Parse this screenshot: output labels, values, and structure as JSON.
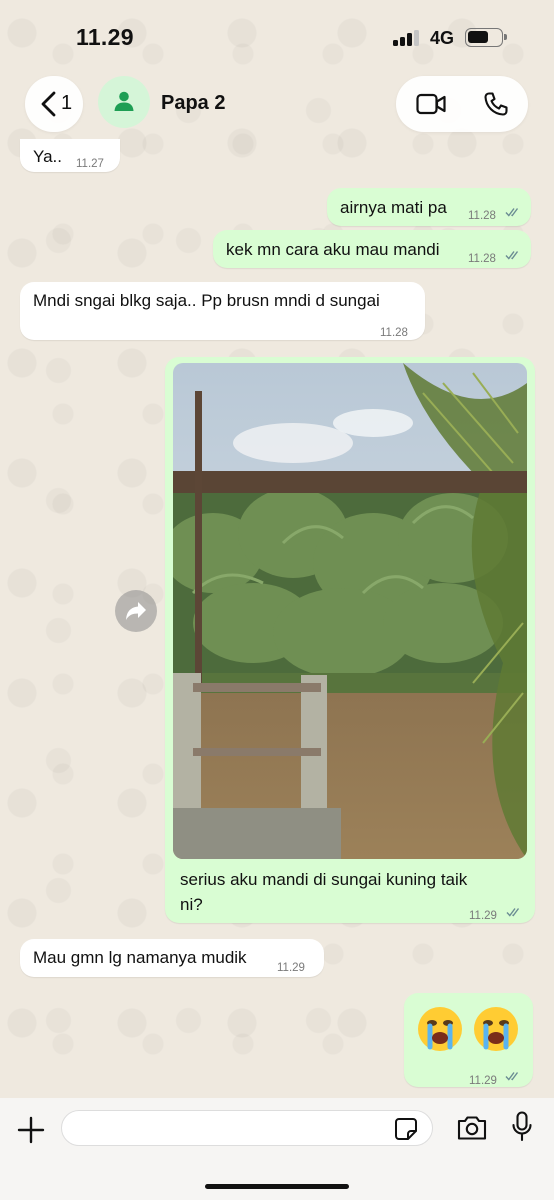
{
  "status_bar": {
    "time": "11.29",
    "network": "4G",
    "battery_level": 0.55
  },
  "header": {
    "back_count": "1",
    "contact_name": "Papa 2",
    "icons": [
      "back-chevron-icon",
      "person-icon",
      "video-call-icon",
      "phone-icon"
    ]
  },
  "messages": [
    {
      "direction": "in",
      "text": "Ya..",
      "time": "11.27"
    },
    {
      "direction": "out",
      "text": "airnya mati pa",
      "time": "11.28",
      "read": true
    },
    {
      "direction": "out",
      "text": "kek mn cara aku mau mandi",
      "time": "11.28",
      "read": true
    },
    {
      "direction": "in",
      "text": "Mndi sngai blkg saja.. Pp brusn mndi d sungai",
      "time": "11.28"
    },
    {
      "direction": "out",
      "type": "image",
      "image_description_icon": "river-photo",
      "caption_line1": "serius aku mandi di sungai kuning taik",
      "caption_line2": "ni?",
      "time": "11.29",
      "read": true
    },
    {
      "direction": "in",
      "text": "Mau gmn lg namanya mudik",
      "time": "11.29"
    },
    {
      "direction": "out",
      "text": "😭 😭",
      "time": "11.29",
      "read": true
    }
  ],
  "input": {
    "placeholder": "",
    "icons": [
      "plus-icon",
      "sticker-icon",
      "camera-icon",
      "microphone-icon"
    ]
  },
  "colors": {
    "outgoing_bubble": "#d9fdd3",
    "incoming_bubble": "#ffffff",
    "read_ticks": "#6b8c93",
    "wallpaper": "#efe9df"
  }
}
